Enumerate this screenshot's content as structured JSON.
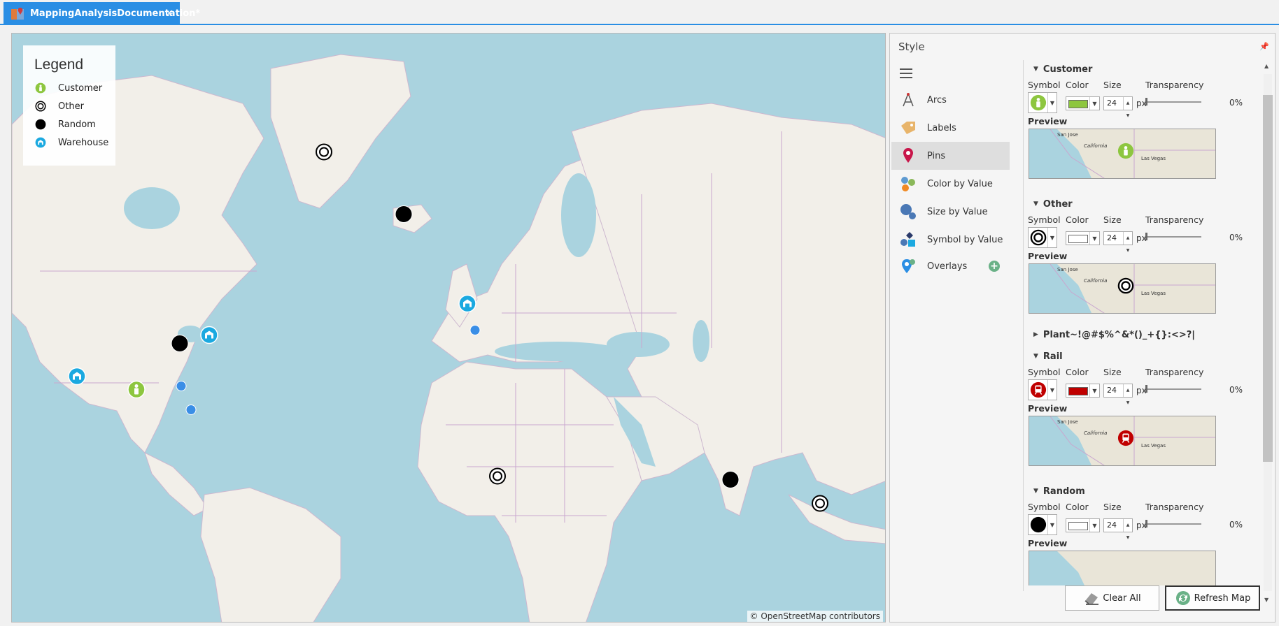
{
  "tab": {
    "title": "MappingAnalysisDocumentation*",
    "close": "×"
  },
  "map": {
    "attribution": "© OpenStreetMap contributors",
    "legend": {
      "title": "Legend",
      "items": [
        {
          "label": "Customer",
          "icon": "customer-pin-icon"
        },
        {
          "label": "Other",
          "icon": "other-ring-icon"
        },
        {
          "label": "Random",
          "icon": "random-dot-icon"
        },
        {
          "label": "Warehouse",
          "icon": "warehouse-pin-icon"
        }
      ]
    }
  },
  "style_panel": {
    "title": "Style",
    "nav": [
      {
        "label": "Arcs",
        "icon": "compass-icon"
      },
      {
        "label": "Labels",
        "icon": "tag-icon"
      },
      {
        "label": "Pins",
        "icon": "map-pin-icon",
        "active": true
      },
      {
        "label": "Color by Value",
        "icon": "color-dots-icon"
      },
      {
        "label": "Size by Value",
        "icon": "size-circles-icon"
      },
      {
        "label": "Symbol by Value",
        "icon": "shapes-icon"
      },
      {
        "label": "Overlays",
        "icon": "overlay-pin-icon"
      }
    ],
    "field_labels": {
      "symbol": "Symbol",
      "color": "Color",
      "size": "Size",
      "transparency": "Transparency",
      "preview": "Preview",
      "unit": "px"
    },
    "preview_cities": {
      "a": "San Jose",
      "b": "California",
      "c": "Las Vegas"
    },
    "layers": [
      {
        "name": "Customer",
        "expanded": true,
        "size": "24",
        "transparency": "0%",
        "swatch": "#8dc63f"
      },
      {
        "name": "Other",
        "expanded": true,
        "size": "24",
        "transparency": "0%",
        "swatch": "#ffffff"
      },
      {
        "name": "Plant~!@#$%^&*()_+{}:<>?|",
        "expanded": false
      },
      {
        "name": "Rail",
        "expanded": true,
        "size": "24",
        "transparency": "0%",
        "swatch": "#c00000"
      },
      {
        "name": "Random",
        "expanded": true,
        "size": "24",
        "transparency": "0%",
        "swatch": "#ffffff"
      }
    ],
    "buttons": {
      "clear": "Clear All",
      "refresh": "Refresh Map"
    }
  },
  "colors": {
    "accent": "#2a8ee4",
    "customer": "#8dc63f",
    "warehouse": "#1ba9e0",
    "rail": "#c00000",
    "random_blue": "#3a8ee6"
  }
}
